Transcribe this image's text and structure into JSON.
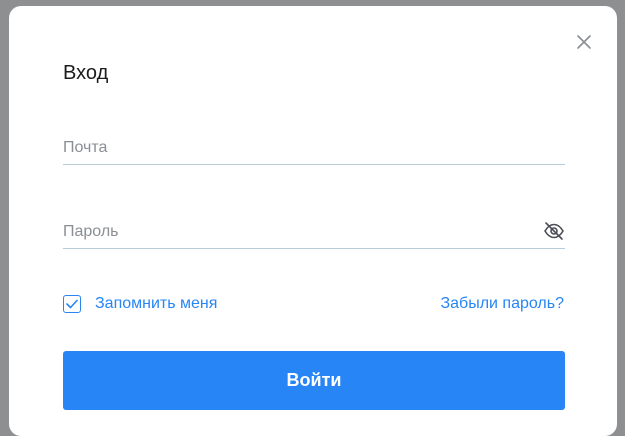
{
  "modal": {
    "title": "Вход",
    "close_icon": "close-icon"
  },
  "form": {
    "email": {
      "placeholder": "Почта",
      "value": ""
    },
    "password": {
      "placeholder": "Пароль",
      "value": "",
      "toggle_icon": "eye-off-icon"
    },
    "remember_me": {
      "label": "Запомнить меня",
      "checked": true
    },
    "forgot_password": "Забыли пароль?",
    "submit_label": "Войти"
  },
  "colors": {
    "accent": "#2785f5",
    "field_border": "#b8cdd9",
    "title_text": "#1c1c1e",
    "placeholder_text": "#8a8f94",
    "overlay": "#8e8f91"
  }
}
